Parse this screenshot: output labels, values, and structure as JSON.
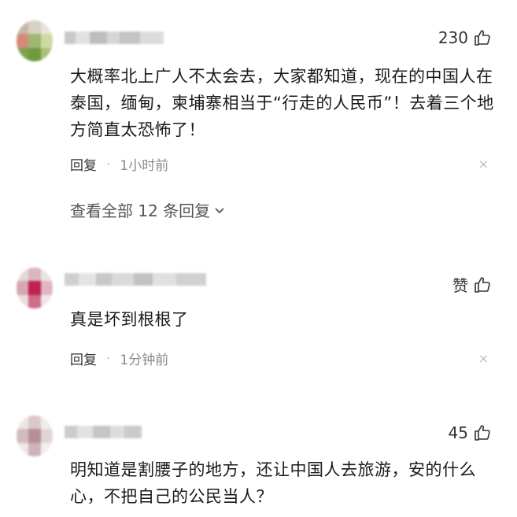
{
  "comments": [
    {
      "likes": "230",
      "text_lines": [
        "大概率北上广人不太会去，大家都知道，现在的中国人在",
        "泰国，缅甸，柬埔寨相当于“行走的人民币”！去着三个地",
        "方简直太恐怖了！"
      ],
      "reply_label": "回复",
      "dot": "·",
      "time": "1小时前",
      "close": "×",
      "view_all": "查看全部 12 条回复"
    },
    {
      "likes": "赞",
      "text_lines": [
        "真是坏到根根了"
      ],
      "reply_label": "回复",
      "dot": "·",
      "time": "1分钟前",
      "close": "×"
    },
    {
      "likes": "45",
      "text_lines": [
        "明知道是割腰子的地方，还让中国人去旅游，安的什么",
        "心，不把自己的公民当人？"
      ]
    }
  ],
  "colors": {
    "text": "#1a1a1a",
    "meta": "#8a8a8a",
    "icon": "#333333"
  }
}
